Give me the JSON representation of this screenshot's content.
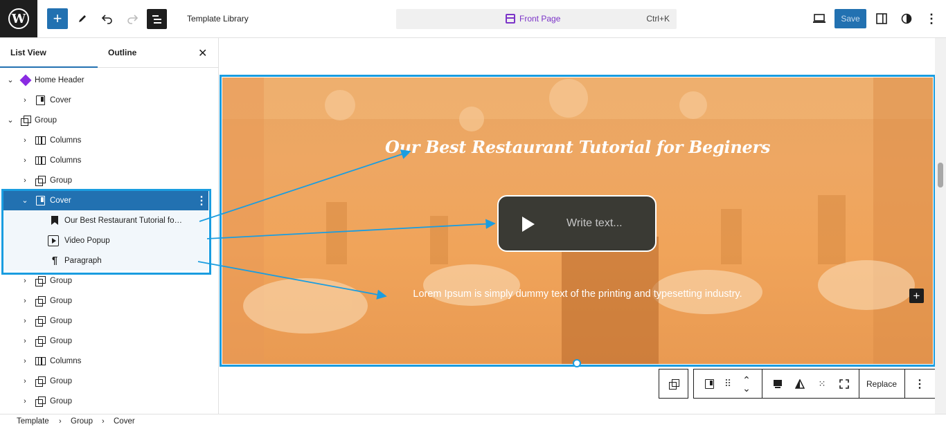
{
  "topbar": {
    "add_icon": "plus-icon",
    "doc_title": "Template Library",
    "command": {
      "title": "Front Page",
      "shortcut": "Ctrl+K"
    },
    "save_label": "Save"
  },
  "sidebar": {
    "tabs": [
      "List View",
      "Outline"
    ],
    "tree": [
      {
        "label": "Home Header",
        "icon": "diamond-icon",
        "expanded": true,
        "level": 0
      },
      {
        "label": "Cover",
        "icon": "cover-icon",
        "expanded": false,
        "level": 1
      },
      {
        "label": "Group",
        "icon": "group-icon",
        "expanded": true,
        "level": 0
      },
      {
        "label": "Columns",
        "icon": "columns-icon",
        "expanded": false,
        "level": 1
      },
      {
        "label": "Columns",
        "icon": "columns-icon",
        "expanded": false,
        "level": 1
      },
      {
        "label": "Group",
        "icon": "group-icon",
        "expanded": false,
        "level": 1
      },
      {
        "label": "Cover",
        "icon": "cover-icon",
        "expanded": true,
        "level": 1,
        "selected": true
      },
      {
        "label": "Our Best Restaurant Tutorial fo…",
        "icon": "bookmark-icon",
        "level": 2
      },
      {
        "label": "Video Popup",
        "icon": "video-icon",
        "level": 2
      },
      {
        "label": "Paragraph",
        "icon": "paragraph-icon",
        "level": 2
      },
      {
        "label": "Group",
        "icon": "group-icon",
        "expanded": false,
        "level": 1
      },
      {
        "label": "Group",
        "icon": "group-icon",
        "expanded": false,
        "level": 1
      },
      {
        "label": "Group",
        "icon": "group-icon",
        "expanded": false,
        "level": 1
      },
      {
        "label": "Group",
        "icon": "group-icon",
        "expanded": false,
        "level": 1
      },
      {
        "label": "Columns",
        "icon": "columns-icon",
        "expanded": false,
        "level": 1
      },
      {
        "label": "Group",
        "icon": "group-icon",
        "expanded": false,
        "level": 1
      },
      {
        "label": "Group",
        "icon": "group-icon",
        "expanded": false,
        "level": 1
      }
    ]
  },
  "breadcrumb": [
    "Template",
    "Group",
    "Cover"
  ],
  "cover": {
    "title": "Our Best Restaurant Tutorial for Beginers",
    "video_placeholder": "Write text...",
    "paragraph": "Lorem Ipsum is simply dummy text of the printing and typesetting industry."
  },
  "block_toolbar": {
    "replace_label": "Replace"
  },
  "colors": {
    "accent": "#2271b1",
    "highlight": "#1a9de0",
    "cover_overlay": "#f0a45a",
    "brand_purple": "#7b33c8"
  }
}
